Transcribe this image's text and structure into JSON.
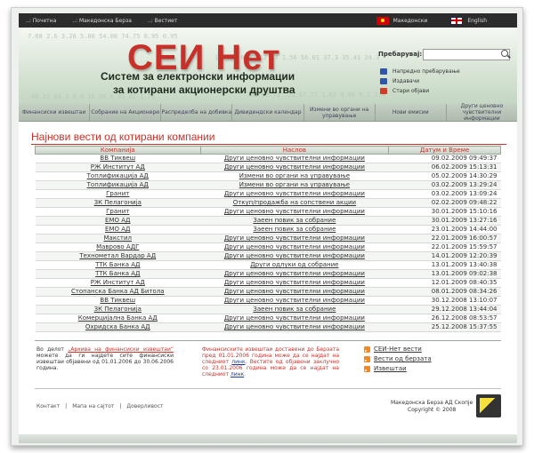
{
  "topbar": {
    "links": [
      "..: Почетна",
      "..: Македонска Берза",
      "..: Вестиет"
    ],
    "lang_mk": "Македонски",
    "lang_en": "English"
  },
  "header": {
    "logo": "СЕИ Нет",
    "tagline_1": "Систем за електронски информации",
    "tagline_2": "за котирани акционерски друштва",
    "bg_numbers": [
      "7.68 2.6 3.26 5.08 54.08 74.75 0.95 0.95",
      "1.2 06 0.00 12 13 1.56 56.01 37.3 35.41 24.3",
      "00 58.73 .53 97.72 1.02 0.00 9.1 2.4",
      "40.33 64.3 9.0 16.98 0.99 62 1.75"
    ]
  },
  "search": {
    "label": "Пребарувај:",
    "value": "",
    "placeholder": "",
    "links": [
      "Напредно пребарување",
      "Издавачи",
      "Стари објави"
    ],
    "link_colors": [
      "#2f55a8",
      "#2f55a8",
      "#d23a2a"
    ]
  },
  "nav": [
    "Финансиски извештаи",
    "Собрание на Акционери",
    "Распределба на добивка",
    "Дивидендски календар",
    "Измени во органи на управување",
    "Нови емисии",
    "Други ценовно чувствителни информации"
  ],
  "page_title": "Најнови вести од котирани компании",
  "table": {
    "headers": [
      "Компанија",
      "Наслов",
      "Датум и Време"
    ],
    "rows": [
      [
        "ВВ Тиквеш",
        "Други ценовно чувствителни информации",
        "09.02.2009 09:49:37"
      ],
      [
        "РЖ Институт АД",
        "Други ценовно чувствителни информации",
        "06.02.2009 15:13:31"
      ],
      [
        "Топлификација АД",
        "Измени во органи на управување",
        "05.02.2009 14:30:29"
      ],
      [
        "Топлификација АД",
        "Измени во органи на управување",
        "03.02.2009 13:29:24"
      ],
      [
        "Гранит",
        "Други ценовно чувствителни информации",
        "03.02.2009 13:09:24"
      ],
      [
        "ЗК Пелагонија",
        "Откуп/продажба на сопствени акции",
        "02.02.2009 09:48:22"
      ],
      [
        "Гранит",
        "Други ценовно чувствителни информации",
        "30.01.2009 15:10:16"
      ],
      [
        "ЕМО АД",
        "Заеен повик за собрание",
        "30.01.2009 13:27:16"
      ],
      [
        "ЕМО АД",
        "Заеен повик за собрание",
        "23.01.2009 14:44:00"
      ],
      [
        "Макстил",
        "Други ценовно чувствителни информации",
        "22.01.2009 16:00:57"
      ],
      [
        "Мавровo АДГ",
        "Други ценовно чувствителни информации",
        "22.01.2009 15:59:57"
      ],
      [
        "Технометал Вардар АД",
        "Други ценовно чувствителни информации",
        "14.01.2009 12:20:39"
      ],
      [
        "ТТК Банка АД",
        "Други одлуки од собрание",
        "13.01.2009 13:40:38"
      ],
      [
        "ТТК Банка АД",
        "Други ценовно чувствителни информации",
        "13.01.2009 09:02:38"
      ],
      [
        "РЖ Институт АД",
        "Други ценовно чувствителни информации",
        "12.01.2009 08:40:35"
      ],
      [
        "Стопанска Банка АД Битола",
        "Други ценовно чувствителни информации",
        "08.01.2009 08:34:26"
      ],
      [
        "ВВ Тиквеш",
        "Други ценовно чувствителни информации",
        "30.12.2008 13:10:07"
      ],
      [
        "ЗК Пелагонија",
        "Заеен повик за собрание",
        "29.12.2008 13:44:04"
      ],
      [
        "Комерцијална Банка АД",
        "Други ценовно чувствителни информации",
        "26.12.2008 08:53:57"
      ],
      [
        "Охридска Банка АД",
        "Други ценовно чувствителни информации",
        "25.12.2008 15:37:55"
      ]
    ]
  },
  "notes": {
    "note1_pre": "Во делот ",
    "note1_link": "„Архива на финансиски извештаи“",
    "note1_post": " можете да ги најдете сите финансиски извештаи објавени од 01.01.2006 до 30.06.2006 година.",
    "note2_a": "Финансиските извештаи доставени до Берзата пред 01.01.2006 година може да се најдат на следниот ",
    "note2_link1": "линк",
    "note2_b": ". Вестите од објавени заклучно со 23.01.2006 година може да се најдат на следниот ",
    "note2_link2": "линк",
    "note2_c": "."
  },
  "rss": [
    "СЕИ-Нет вести",
    "Вести од берзата",
    "Извештаи"
  ],
  "footer": {
    "links": [
      "Контакт",
      "Мапа на сајтот",
      "Доверливост"
    ],
    "company": "Македонска Берза АД Скопје",
    "copyright": "Copyright © 2008"
  }
}
